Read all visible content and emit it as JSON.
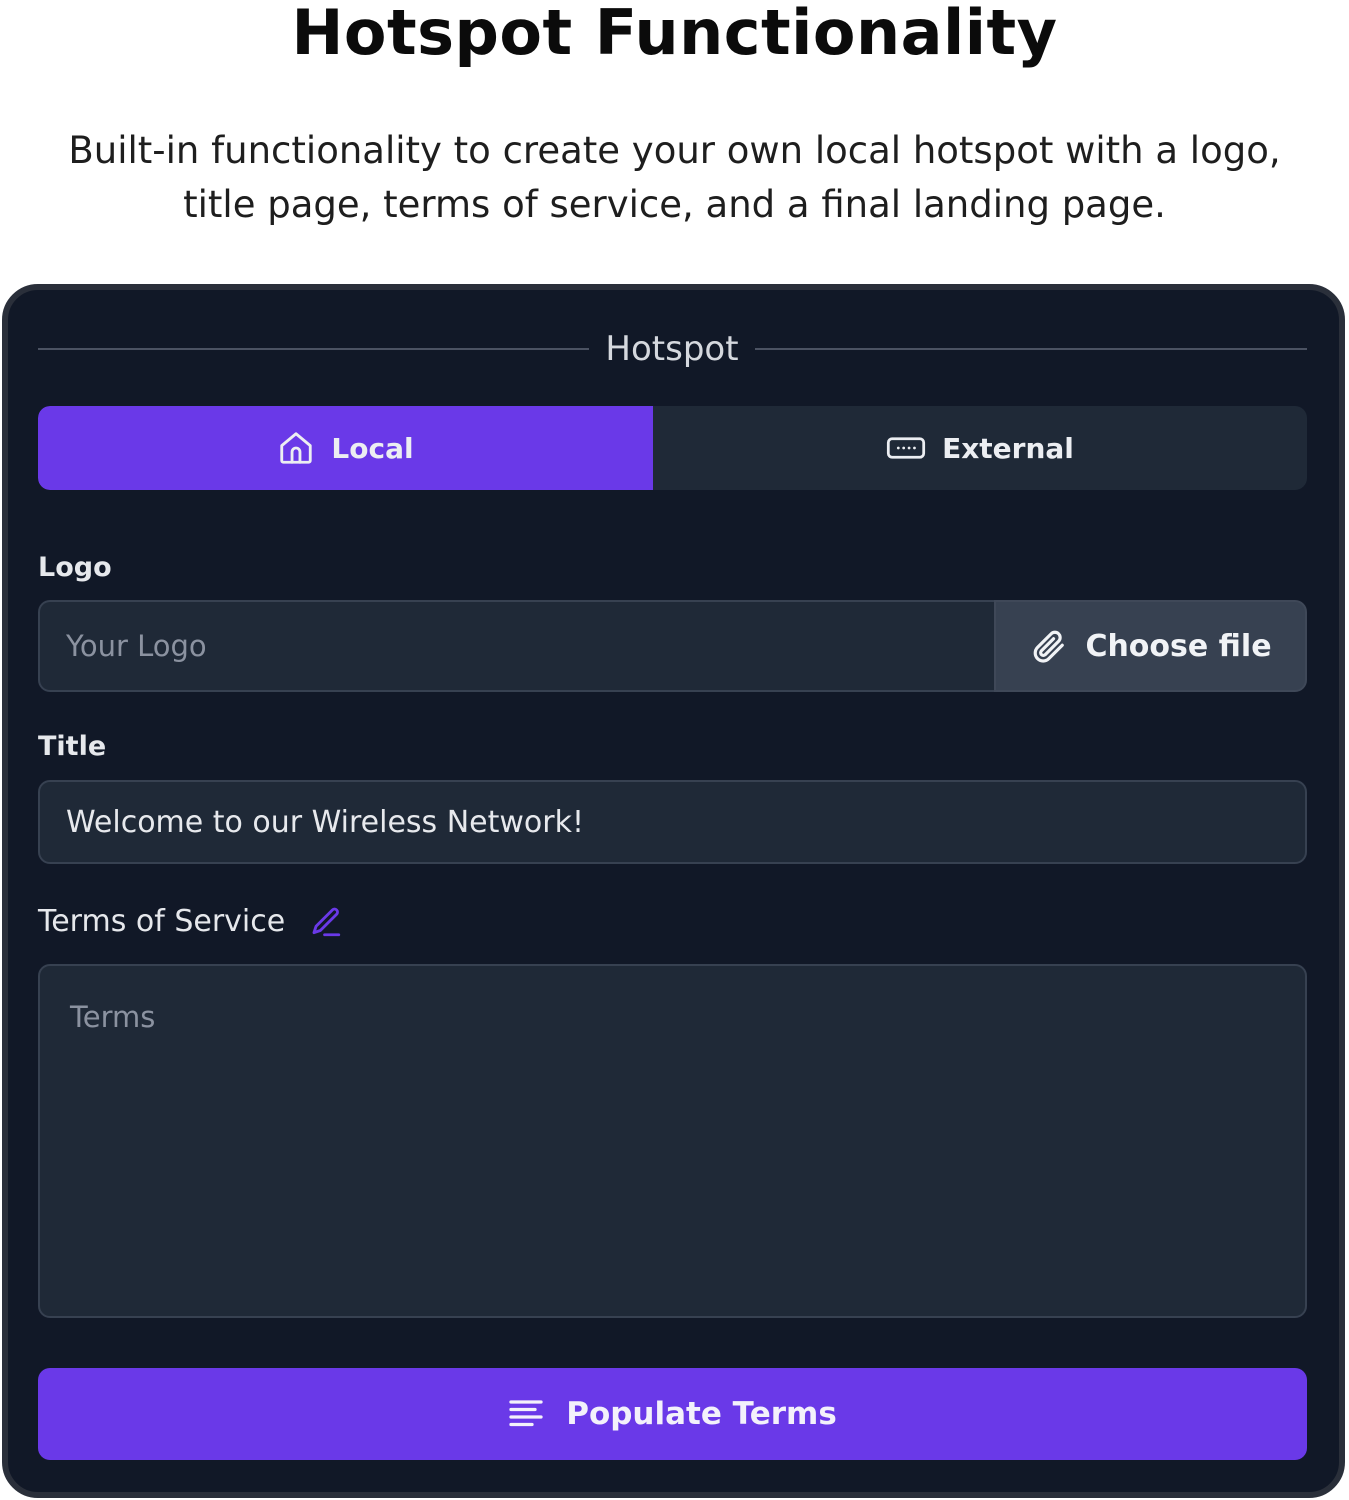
{
  "header": {
    "title": "Hotspot Functionality",
    "description": "Built-in functionality to create your own local hotspot with a logo, title page, terms of service, and a final landing page."
  },
  "panel": {
    "legend": "Hotspot",
    "tabs": [
      {
        "label": "Local",
        "icon": "home-icon",
        "active": true
      },
      {
        "label": "External",
        "icon": "input-dots-icon",
        "active": false
      }
    ],
    "logo": {
      "label": "Logo",
      "placeholder": "Your Logo",
      "button_label": "Choose file",
      "button_icon": "paperclip-icon"
    },
    "title": {
      "label": "Title",
      "value": "Welcome to our Wireless Network!"
    },
    "terms": {
      "label": "Terms of Service",
      "edit_icon": "pencil-icon",
      "placeholder": "Terms"
    },
    "populate_button": {
      "label": "Populate Terms",
      "icon": "text-lines-icon"
    }
  },
  "colors": {
    "accent": "#6a39e8",
    "panel_bg": "#111827",
    "input_bg": "#1f2937",
    "border": "#374151"
  }
}
